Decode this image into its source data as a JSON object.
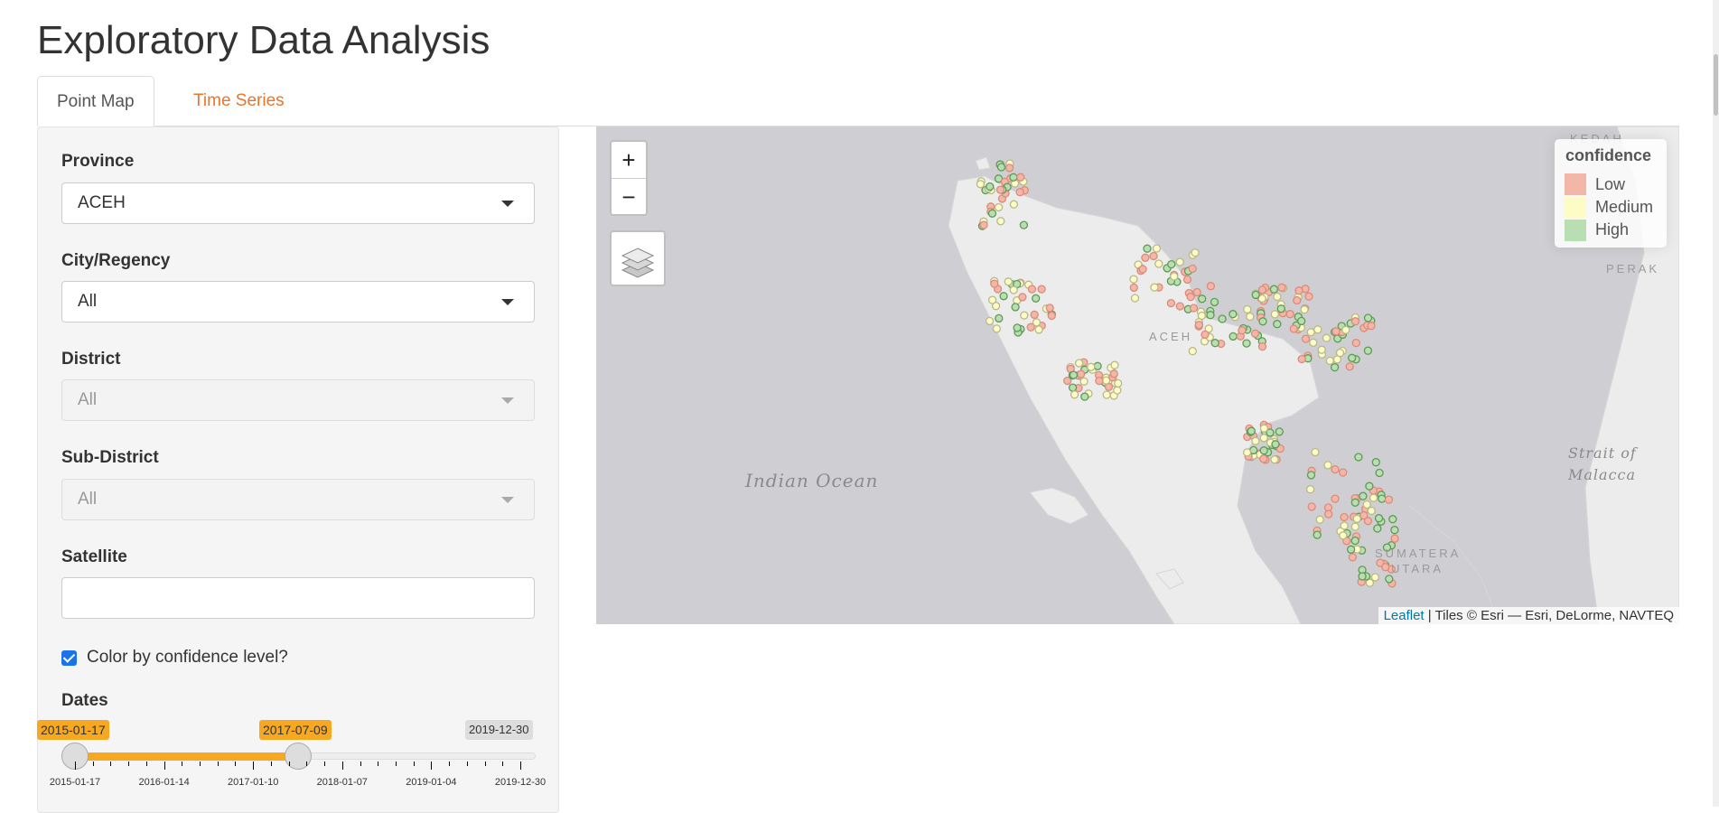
{
  "page": {
    "title": "Exploratory Data Analysis"
  },
  "tabs": [
    {
      "label": "Point Map",
      "active": true
    },
    {
      "label": "Time Series",
      "active": false
    }
  ],
  "filters": {
    "province": {
      "label": "Province",
      "value": "ACEH"
    },
    "city": {
      "label": "City/Regency",
      "value": "All"
    },
    "district": {
      "label": "District",
      "value": "All",
      "disabled": true
    },
    "subdistrict": {
      "label": "Sub-District",
      "value": "All",
      "disabled": true
    },
    "satellite": {
      "label": "Satellite",
      "value": ""
    },
    "color_by_confidence": {
      "label": "Color by confidence level?",
      "checked": true
    },
    "dates": {
      "label": "Dates",
      "from": "2015-01-17",
      "to": "2017-07-09",
      "max": "2019-12-30",
      "ticks": [
        "2015-01-17",
        "2016-01-14",
        "2017-01-10",
        "2018-01-07",
        "2019-01-04",
        "2019-12-30"
      ]
    }
  },
  "map": {
    "legend": {
      "title": "confidence",
      "items": [
        {
          "label": "Low",
          "color": "#f4b6a7"
        },
        {
          "label": "Medium",
          "color": "#fdfbc6"
        },
        {
          "label": "High",
          "color": "#b9deb1"
        }
      ]
    },
    "attribution": {
      "link": "Leaflet",
      "text": " | Tiles © Esri — Esri, DeLorme, NAVTEQ"
    },
    "labels": {
      "ocean": "Indian Ocean",
      "strait_line1": "Strait of",
      "strait_line2": "Malacca",
      "region": "ACEH",
      "north_sumatra_line1": "SUMATERA",
      "north_sumatra_line2": "UTARA",
      "perak": "PERAK",
      "kedah": "KEDAH"
    },
    "zoom_in": "+",
    "zoom_out": "−"
  }
}
